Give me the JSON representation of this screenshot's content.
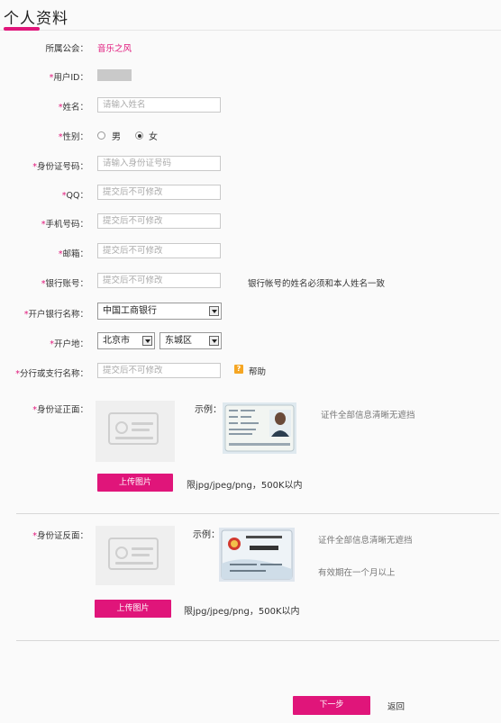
{
  "page": {
    "title": "个人资料"
  },
  "form": {
    "guild_label": "所属公会：",
    "guild_value": "音乐之风",
    "uid_label": "用户ID：",
    "name_label": "姓名：",
    "name_placeholder": "请输入姓名",
    "gender_label": "性别：",
    "gender_male": "男",
    "gender_female": "女",
    "gender_selected": "女",
    "idno_label": "身份证号码：",
    "idno_placeholder": "请输入身份证号码",
    "qq_label": "QQ：",
    "qq_placeholder": "提交后不可修改",
    "phone_label": "手机号码：",
    "phone_placeholder": "提交后不可修改",
    "email_label": "邮箱：",
    "email_placeholder": "提交后不可修改",
    "bank_acct_label": "银行账号：",
    "bank_acct_placeholder": "提交后不可修改",
    "bank_acct_note": "银行帐号的姓名必须和本人姓名一致",
    "bank_name_label": "开户银行名称：",
    "bank_name_value": "中国工商银行",
    "region_label": "开户地：",
    "region_city": "北京市",
    "region_district": "东城区",
    "branch_label": "分行或支行名称：",
    "branch_placeholder": "提交后不可修改",
    "help_text": "帮助",
    "help_icon": "?"
  },
  "upload_front": {
    "label": "身份证正面：",
    "example_label": "示例：",
    "button": "上传图片",
    "hint": "限jpg/jpeg/png，500K以内",
    "note": "证件全部信息清晰无遮挡"
  },
  "upload_back": {
    "label": "身份证反面：",
    "example_label": "示例：",
    "button": "上传图片",
    "hint": "限jpg/jpeg/png，500K以内",
    "note1": "证件全部信息清晰无遮挡",
    "note2": "有效期在一个月以上"
  },
  "actions": {
    "next": "下一步",
    "back": "返回"
  },
  "colors": {
    "accent": "#e0157a",
    "help": "#f5a623"
  }
}
